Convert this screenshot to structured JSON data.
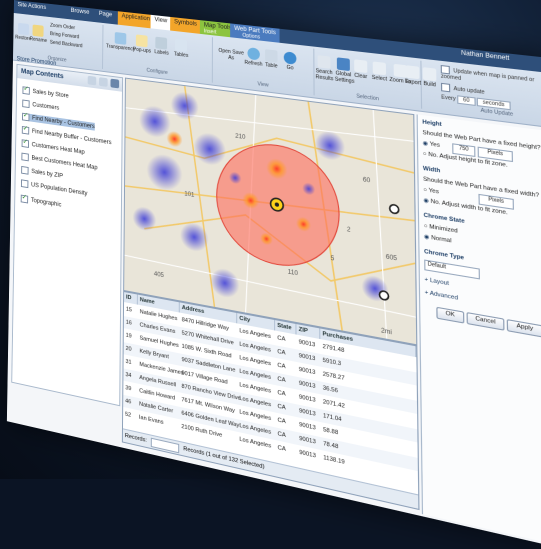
{
  "ribbon": {
    "tabs": [
      "Site Actions",
      "Browse",
      "Page",
      "Application",
      "View",
      "Symbols",
      "Map Tools",
      "Web Part Tools",
      "Insert",
      "Options"
    ],
    "user": "Nathan Bennett",
    "buttons": [
      "Restore",
      "Rename",
      "Zoom Order",
      "Bring Forward",
      "Send Backward",
      "Transparency",
      "Pop-ups",
      "Labels",
      "Tables",
      "Open Save As",
      "Refresh",
      "Table",
      "Go",
      "Search Results",
      "Global Settings",
      "Clear",
      "Select",
      "Zoom To",
      "Export",
      "Build"
    ],
    "groups": [
      "Organize",
      "Configure",
      "View",
      "Selection"
    ],
    "update_when": "Update when map is panned or zoomed",
    "auto_update_label": "Auto update",
    "every_label": "Every",
    "every_value": "60",
    "unit_value": "seconds",
    "auto_update_group": "Auto Update"
  },
  "toc": {
    "panel_title": "Store Promotion",
    "title": "Map Contents",
    "items": [
      {
        "label": "Sales by Store",
        "checked": true
      },
      {
        "label": "Customers",
        "checked": false
      },
      {
        "label": "Find Nearby - Customers",
        "checked": true
      },
      {
        "label": "Find Nearby Buffer - Customers",
        "checked": true
      },
      {
        "label": "Customers Heat Map",
        "checked": true
      },
      {
        "label": "Best Customers Heat Map",
        "checked": false
      },
      {
        "label": "Sales by ZIP",
        "checked": false
      },
      {
        "label": "US Population Density",
        "checked": false
      },
      {
        "label": "Topographic",
        "checked": true
      }
    ]
  },
  "grid": {
    "headers": [
      "ID",
      "Name",
      "Address",
      "City",
      "State",
      "ZIP",
      "Purchases"
    ],
    "rows": [
      [
        "15",
        "Natalie Hughes",
        "8470 Hillridge Way",
        "Los Angeles",
        "CA",
        "90013",
        "2791.48"
      ],
      [
        "16",
        "Charles Evans",
        "5270 Whitehall Drive",
        "Los Angeles",
        "CA",
        "90013",
        "5910.3"
      ],
      [
        "19",
        "Samuel Hughes",
        "1085 W. Sixth Road",
        "Los Angeles",
        "CA",
        "90013",
        "2578.27"
      ],
      [
        "20",
        "Kelly Bryant",
        "9037 Saddleton Lane",
        "Los Angeles",
        "CA",
        "90013",
        "36.56"
      ],
      [
        "31",
        "Mackenzie James",
        "9017 Village Road",
        "Los Angeles",
        "CA",
        "90013",
        "2071.42"
      ],
      [
        "34",
        "Angela Russell",
        "870 Rancho View Drive",
        "Los Angeles",
        "CA",
        "90013",
        "171.04"
      ],
      [
        "39",
        "Caitlin Howard",
        "7617 Mt. Wilson Way",
        "Los Angeles",
        "CA",
        "90013",
        "58.88"
      ],
      [
        "46",
        "Natalie Carter",
        "6406 Golden Leaf Way",
        "Los Angeles",
        "CA",
        "90013",
        "78.48"
      ],
      [
        "52",
        "Ian Evans",
        "2100 Ruth Drive",
        "Los Angeles",
        "CA",
        "90013",
        "1138.19"
      ]
    ],
    "footer_records": "Records:",
    "footer_status": "Records (1 out of 132 Selected)"
  },
  "props": {
    "height_title": "Height",
    "height_q": "Should the Web Part have a fixed height?",
    "yes": "Yes",
    "height_value": "750",
    "pixels": "Pixels",
    "no_adjust_h": "No. Adjust height to fit zone.",
    "width_title": "Width",
    "width_q": "Should the Web Part have a fixed width?",
    "no_adjust_w": "No. Adjust width to fit zone.",
    "chrome_state": "Chrome State",
    "minimized": "Minimized",
    "normal": "Normal",
    "chrome_type": "Chrome Type",
    "chrome_type_value": "Default",
    "layout": "Layout",
    "advanced": "Advanced",
    "ok": "OK",
    "cancel": "Cancel",
    "apply": "Apply"
  },
  "map": {
    "labels": [
      "60",
      "2",
      "210",
      "5",
      "101",
      "110",
      "605",
      "405"
    ],
    "scale": "2mi"
  }
}
